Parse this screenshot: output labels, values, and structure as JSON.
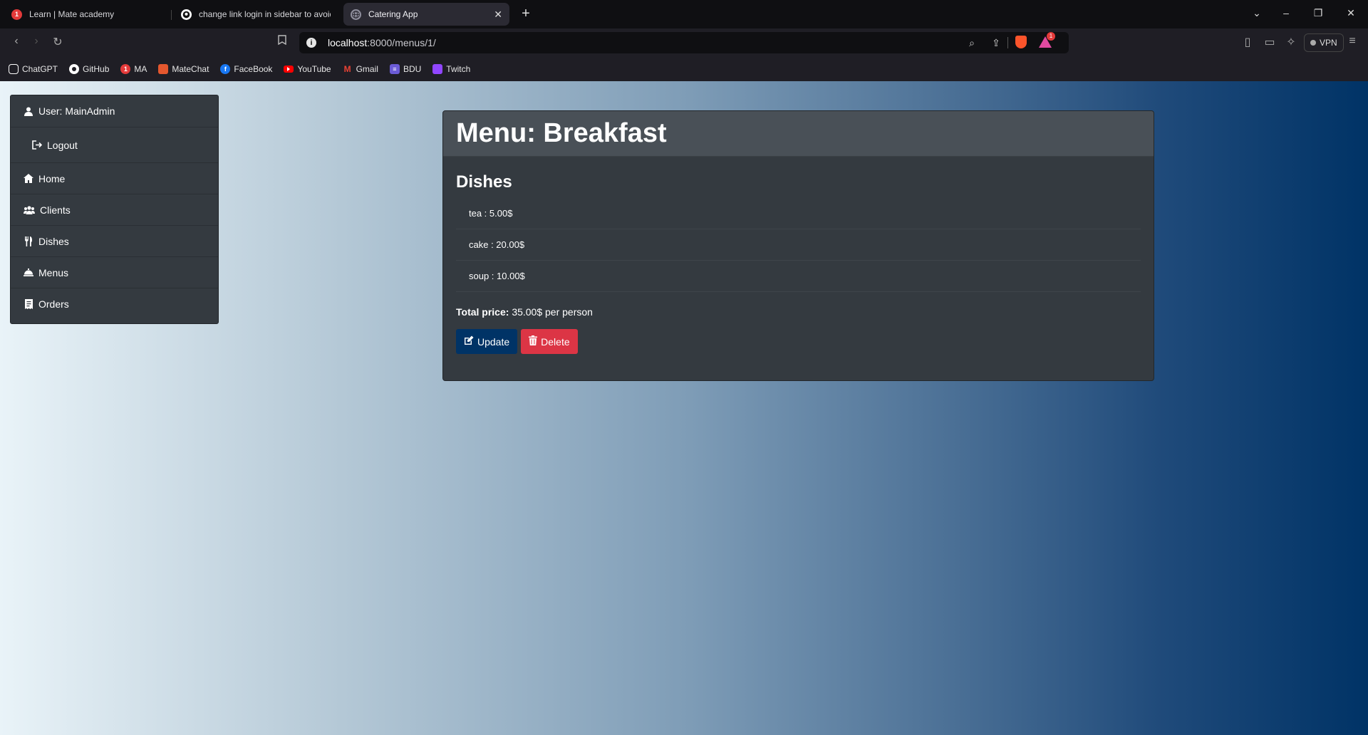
{
  "browser": {
    "tabs": [
      {
        "title": "Learn | Mate academy",
        "favicon": "mate-academy-icon",
        "badge": "1"
      },
      {
        "title": "change link login in sidebar to avoid",
        "favicon": "github-icon"
      },
      {
        "title": "Catering App",
        "favicon": "globe-icon",
        "active": true
      }
    ],
    "url_host": "localhost",
    "url_rest": ":8000/menus/1/",
    "vpn_label": "VPN",
    "rewards_badge": "1",
    "bookmarks": [
      {
        "label": "ChatGPT",
        "icon": "chatgpt-icon",
        "color": "#ffffff"
      },
      {
        "label": "GitHub",
        "icon": "github-icon",
        "color": "#ffffff"
      },
      {
        "label": "MA",
        "icon": "mate-academy-icon",
        "color": "#e43a3a",
        "badge": "1"
      },
      {
        "label": "MateChat",
        "icon": "matechat-icon",
        "color": "#e4572e"
      },
      {
        "label": "FaceBook",
        "icon": "facebook-icon",
        "color": "#1877f2"
      },
      {
        "label": "YouTube",
        "icon": "youtube-icon",
        "color": "#ff0000"
      },
      {
        "label": "Gmail",
        "icon": "gmail-icon",
        "color": "#ea4335"
      },
      {
        "label": "BDU",
        "icon": "bdu-icon",
        "color": "#6b5bd6"
      },
      {
        "label": "Twitch",
        "icon": "twitch-icon",
        "color": "#9146ff"
      }
    ]
  },
  "sidebar": {
    "user_label": "User: MainAdmin",
    "logout_label": "Logout",
    "items": [
      {
        "label": "Home",
        "icon": "home-icon"
      },
      {
        "label": "Clients",
        "icon": "users-icon"
      },
      {
        "label": "Dishes",
        "icon": "utensils-icon"
      },
      {
        "label": "Menus",
        "icon": "bell-concierge-icon"
      },
      {
        "label": "Orders",
        "icon": "receipt-icon"
      }
    ]
  },
  "menu": {
    "title": "Menu: Breakfast",
    "dishes_heading": "Dishes",
    "dishes": [
      {
        "text": "tea : 5.00$"
      },
      {
        "text": "cake : 20.00$"
      },
      {
        "text": "soup : 10.00$"
      }
    ],
    "total_label": "Total price:",
    "total_value": "35.00$ per person",
    "update_label": "Update",
    "delete_label": "Delete"
  },
  "colors": {
    "update_button": "#003366",
    "delete_button": "#dc3545",
    "card_bg": "#343a40",
    "card_header_bg": "#495057"
  }
}
